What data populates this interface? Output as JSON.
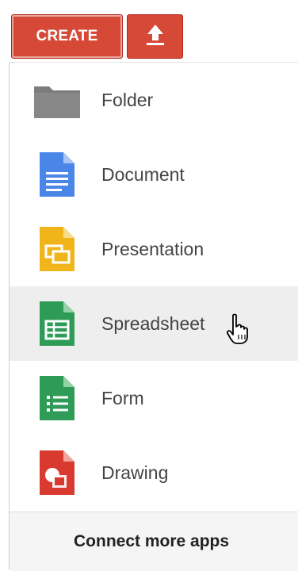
{
  "toolbar": {
    "create_label": "CREATE",
    "upload_icon": "upload-icon"
  },
  "menu": {
    "items": [
      {
        "label": "Folder",
        "icon": "folder-icon",
        "color": "#7c7c7c"
      },
      {
        "label": "Document",
        "icon": "document-icon",
        "color": "#4a86e8"
      },
      {
        "label": "Presentation",
        "icon": "presentation-icon",
        "color": "#f1b51c"
      },
      {
        "label": "Spreadsheet",
        "icon": "spreadsheet-icon",
        "color": "#2e9b57",
        "hovered": true
      },
      {
        "label": "Form",
        "icon": "form-icon",
        "color": "#2e9b57"
      },
      {
        "label": "Drawing",
        "icon": "drawing-icon",
        "color": "#d93a30"
      }
    ],
    "footer_label": "Connect more apps"
  },
  "colors": {
    "accent": "#d64937",
    "hover_bg": "#eeeeee"
  }
}
